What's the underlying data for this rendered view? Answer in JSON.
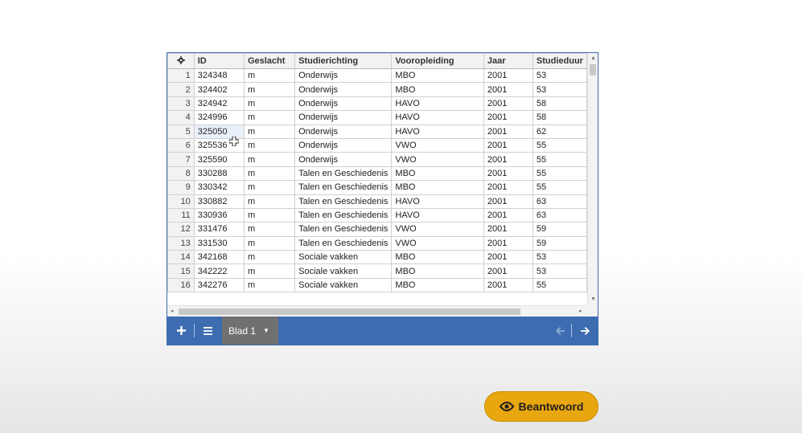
{
  "grid": {
    "columns": [
      "ID",
      "Geslacht",
      "Studierichting",
      "Vooropleiding",
      "Jaar",
      "Studieduur"
    ],
    "rows": [
      {
        "num": "1",
        "cells": [
          "324348",
          "m",
          "Onderwijs",
          "MBO",
          "2001",
          "53"
        ]
      },
      {
        "num": "2",
        "cells": [
          "324402",
          "m",
          "Onderwijs",
          "MBO",
          "2001",
          "53"
        ]
      },
      {
        "num": "3",
        "cells": [
          "324942",
          "m",
          "Onderwijs",
          "HAVO",
          "2001",
          "58"
        ]
      },
      {
        "num": "4",
        "cells": [
          "324996",
          "m",
          "Onderwijs",
          "HAVO",
          "2001",
          "58"
        ]
      },
      {
        "num": "5",
        "cells": [
          "325050",
          "m",
          "Onderwijs",
          "HAVO",
          "2001",
          "62"
        ]
      },
      {
        "num": "6",
        "cells": [
          "325536",
          "m",
          "Onderwijs",
          "VWO",
          "2001",
          "55"
        ]
      },
      {
        "num": "7",
        "cells": [
          "325590",
          "m",
          "Onderwijs",
          "VWO",
          "2001",
          "55"
        ]
      },
      {
        "num": "8",
        "cells": [
          "330288",
          "m",
          "Talen en Geschiedenis",
          "MBO",
          "2001",
          "55"
        ]
      },
      {
        "num": "9",
        "cells": [
          "330342",
          "m",
          "Talen en Geschiedenis",
          "MBO",
          "2001",
          "55"
        ]
      },
      {
        "num": "10",
        "cells": [
          "330882",
          "m",
          "Talen en Geschiedenis",
          "HAVO",
          "2001",
          "63"
        ]
      },
      {
        "num": "11",
        "cells": [
          "330936",
          "m",
          "Talen en Geschiedenis",
          "HAVO",
          "2001",
          "63"
        ]
      },
      {
        "num": "12",
        "cells": [
          "331476",
          "m",
          "Talen en Geschiedenis",
          "VWO",
          "2001",
          "59"
        ]
      },
      {
        "num": "13",
        "cells": [
          "331530",
          "m",
          "Talen en Geschiedenis",
          "VWO",
          "2001",
          "59"
        ]
      },
      {
        "num": "14",
        "cells": [
          "342168",
          "m",
          "Sociale vakken",
          "MBO",
          "2001",
          "53"
        ]
      },
      {
        "num": "15",
        "cells": [
          "342222",
          "m",
          "Sociale vakken",
          "MBO",
          "2001",
          "53"
        ]
      },
      {
        "num": "16",
        "cells": [
          "342276",
          "m",
          "Sociale vakken",
          "MBO",
          "2001",
          "55"
        ]
      }
    ]
  },
  "tabbar": {
    "add_icon": "plus-icon",
    "menu_icon": "hamburger-icon",
    "sheet_tab": "Blad 1",
    "prev_icon": "arrow-left-icon",
    "next_icon": "arrow-right-icon"
  },
  "answer_button": {
    "label": "Beantwoord",
    "icon": "eye-icon",
    "color": "#e8a60f"
  },
  "colors": {
    "accent": "#3d6db0",
    "tab_active": "#707070"
  }
}
